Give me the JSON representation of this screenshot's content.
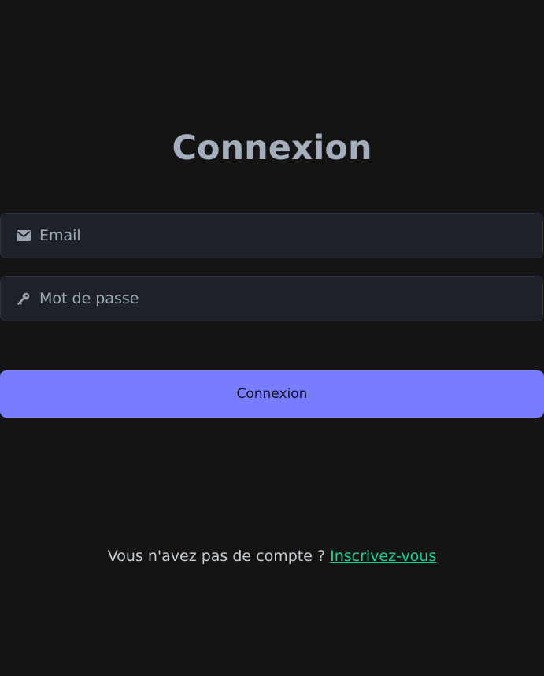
{
  "login": {
    "title": "Connexion",
    "email_placeholder": "Email",
    "email_icon": "envelope-icon",
    "password_placeholder": "Mot de passe",
    "password_icon": "key-icon",
    "submit_label": "Connexion",
    "signup_prompt": "Vous n'avez pas de compte ?",
    "signup_link": "Inscrivez-vous"
  },
  "colors": {
    "background": "#141414",
    "field_background": "#1d222a",
    "accent": "#787cff",
    "link": "#1fcf9a",
    "title": "#a4aebd"
  }
}
